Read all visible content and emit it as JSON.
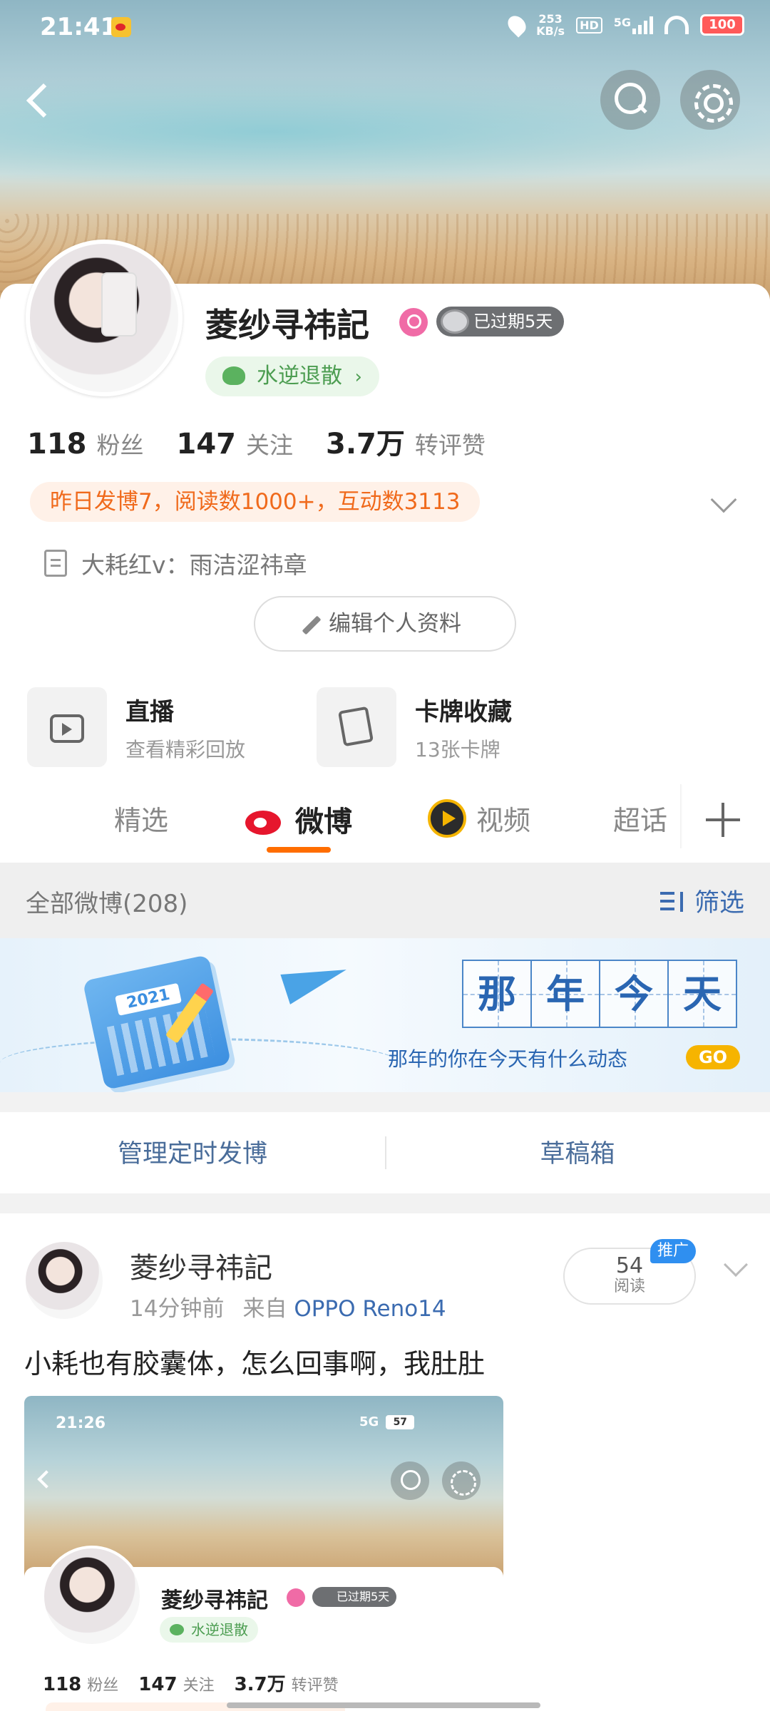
{
  "status_bar": {
    "time": "21:41",
    "speed_value": "253",
    "speed_unit": "KB/s",
    "hd": "HD",
    "network": "5G",
    "battery": "100"
  },
  "header": {
    "back_icon": "back-arrow-icon",
    "search_icon": "search-icon",
    "settings_icon": "gear-icon"
  },
  "profile": {
    "name": "菱纱寻祎記",
    "vip_tag": "已过期5天",
    "title_chip": "水逆退散",
    "stats": [
      {
        "num": "118",
        "label": "粉丝"
      },
      {
        "num": "147",
        "label": "关注"
      },
      {
        "num": "3.7万",
        "label": "转评赞"
      }
    ],
    "activity": "昨日发博7，阅读数1000+，互动数3113",
    "bio": "大耗红v：雨洁涩祎章",
    "edit_button": "编辑个人资料"
  },
  "features": [
    {
      "title": "直播",
      "subtitle": "查看精彩回放",
      "icon": "tv-play-icon"
    },
    {
      "title": "卡牌收藏",
      "subtitle": "13张卡牌",
      "icon": "card-icon"
    }
  ],
  "tabs": [
    "精选",
    "微博",
    "视频",
    "超话"
  ],
  "active_tab": "微博",
  "filter_bar": {
    "all_label": "全部微博(208)",
    "filter_label": "筛选"
  },
  "banner": {
    "year": "2021",
    "chars": [
      "那",
      "年",
      "今",
      "天"
    ],
    "subtitle": "那年的你在今天有什么动态",
    "go": "GO"
  },
  "actions": {
    "scheduled": "管理定时发博",
    "drafts": "草稿箱"
  },
  "post": {
    "author": "菱纱寻祎記",
    "time": "14分钟前",
    "source_prefix": "来自",
    "source": "OPPO Reno14",
    "reads_num": "54",
    "reads_label": "阅读",
    "promo": "推广",
    "text": "小耗也有胶囊体，怎么回事啊，我肚肚",
    "screenshot": {
      "time": "21:26",
      "network": "5G",
      "battery": "57",
      "name": "菱纱寻祎記",
      "vip_tag": "已过期5天",
      "title_chip": "水逆退散",
      "stats": [
        {
          "num": "118",
          "label": "粉丝"
        },
        {
          "num": "147",
          "label": "关注"
        },
        {
          "num": "3.7万",
          "label": "转评赞"
        }
      ]
    }
  },
  "colors": {
    "accent_orange": "#ff6d00",
    "link_blue": "#3b6bb0",
    "weibo_red": "#e6162d",
    "activity_text": "#f06a1c",
    "title_green": "#4c9d51"
  }
}
